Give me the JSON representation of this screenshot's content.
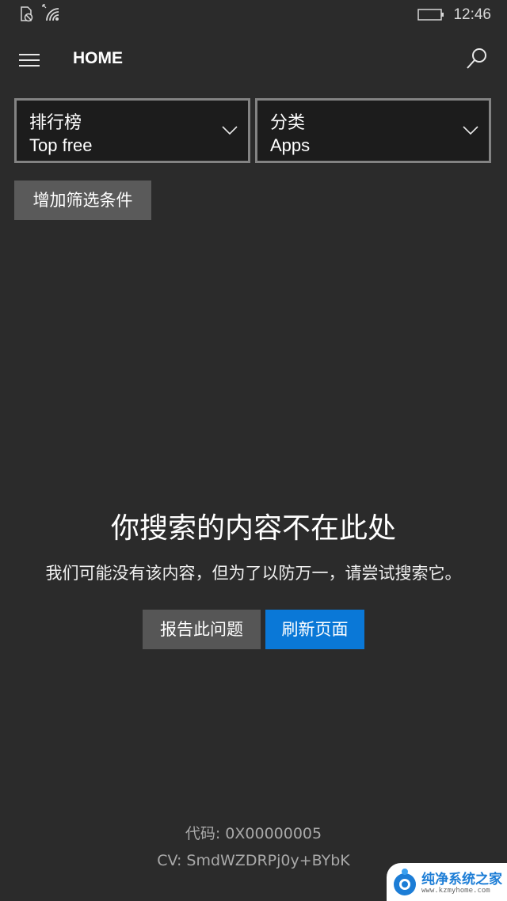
{
  "status_bar": {
    "time": "12:46",
    "icons": [
      "sim-blocked-icon",
      "wifi-icon",
      "battery-icon"
    ]
  },
  "app_bar": {
    "title": "HOME",
    "menu_icon": "hamburger-icon",
    "search_icon": "search-icon"
  },
  "filters": {
    "chart": {
      "label": "排行榜",
      "value": "Top free"
    },
    "category": {
      "label": "分类",
      "value": "Apps"
    },
    "add_filter_label": "增加筛选条件"
  },
  "empty_state": {
    "title": "你搜索的内容不在此处",
    "description": "我们可能没有该内容，但为了以防万一，请尝试搜索它。",
    "report_button": "报告此问题",
    "refresh_button": "刷新页面"
  },
  "footer": {
    "code": "代码: 0X00000005",
    "cv": "CV: SmdWZDRPj0y+BYbK"
  },
  "watermark": {
    "title": "纯净系统之家",
    "url": "www.kzmyhome.com"
  },
  "colors": {
    "background": "#2b2b2b",
    "accent": "#0a78d7",
    "secondary_button": "#565656"
  }
}
